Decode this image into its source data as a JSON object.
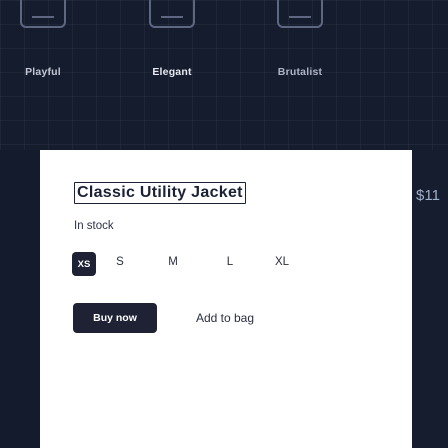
{
  "style_picker": {
    "options": [
      {
        "label": "Playful",
        "icon": "playful-style-icon"
      },
      {
        "label": "Elegant",
        "icon": "elegant-style-icon"
      },
      {
        "label": "Brutalist",
        "icon": "brutalist-style-icon"
      }
    ]
  },
  "product": {
    "title": "Classic Utility Jacket",
    "price": "$11",
    "stock": "In stock",
    "sizes": [
      "XS",
      "S",
      "M",
      "L",
      "XL"
    ],
    "selected_size": "XS"
  },
  "actions": {
    "buy": "Buy now",
    "add_to_bag": "Add to bag"
  },
  "colors": {
    "background": "#121a2c",
    "card": "#ffffff",
    "primary": "#1e2234"
  }
}
